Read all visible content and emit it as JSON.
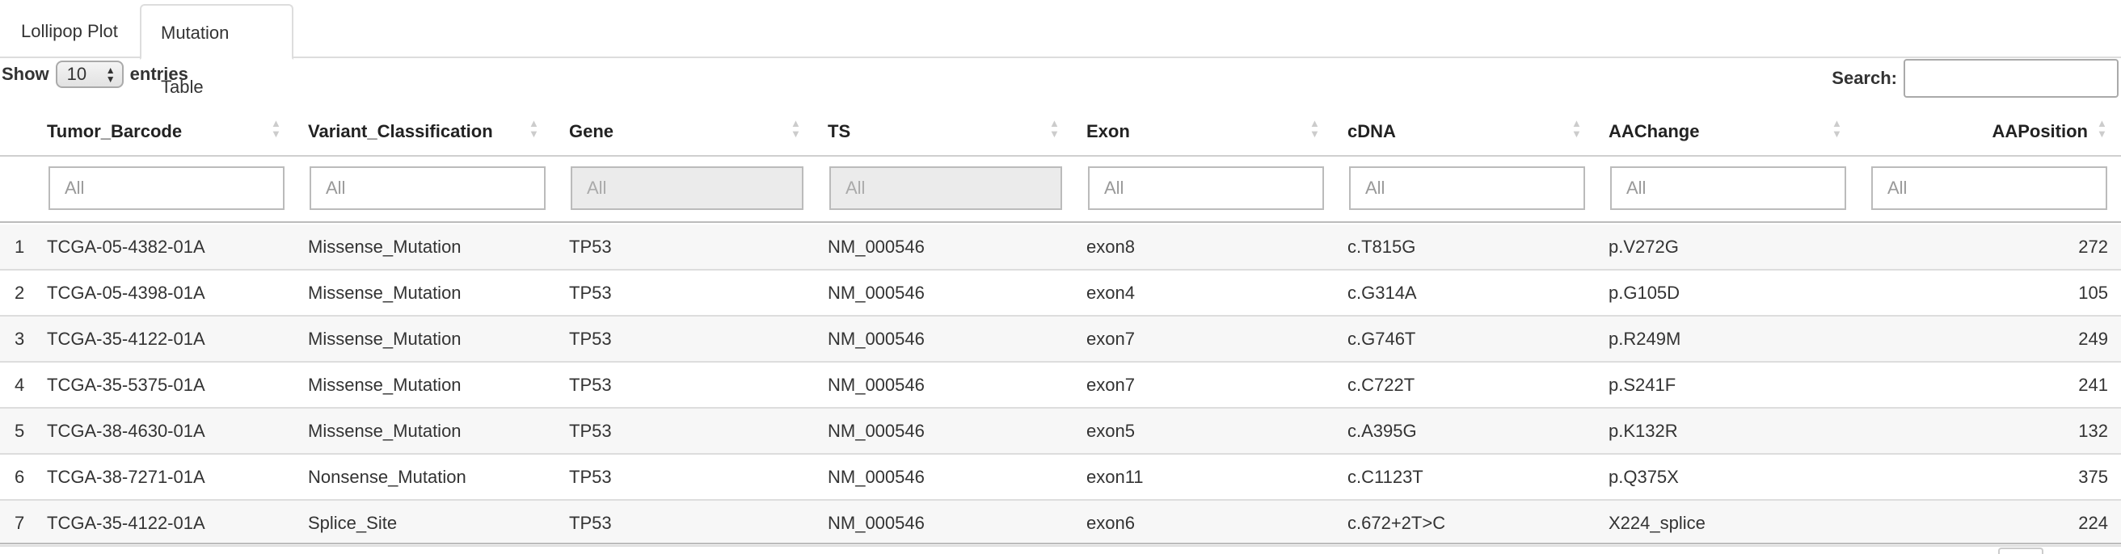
{
  "tabs": [
    {
      "label": "Lollipop Plot"
    },
    {
      "label": "Mutation Table"
    }
  ],
  "length": {
    "prefix": "Show",
    "value": "10",
    "suffix": "entries"
  },
  "search": {
    "label": "Search:",
    "value": ""
  },
  "columns": [
    "Tumor_Barcode",
    "Variant_Classification",
    "Gene",
    "TS",
    "Exon",
    "cDNA",
    "AAChange",
    "AAPosition"
  ],
  "filter_placeholder": "All",
  "rows": [
    {
      "n": "1",
      "Tumor_Barcode": "TCGA-05-4382-01A",
      "Variant_Classification": "Missense_Mutation",
      "Gene": "TP53",
      "TS": "NM_000546",
      "Exon": "exon8",
      "cDNA": "c.T815G",
      "AAChange": "p.V272G",
      "AAPosition": "272"
    },
    {
      "n": "2",
      "Tumor_Barcode": "TCGA-05-4398-01A",
      "Variant_Classification": "Missense_Mutation",
      "Gene": "TP53",
      "TS": "NM_000546",
      "Exon": "exon4",
      "cDNA": "c.G314A",
      "AAChange": "p.G105D",
      "AAPosition": "105"
    },
    {
      "n": "3",
      "Tumor_Barcode": "TCGA-35-4122-01A",
      "Variant_Classification": "Missense_Mutation",
      "Gene": "TP53",
      "TS": "NM_000546",
      "Exon": "exon7",
      "cDNA": "c.G746T",
      "AAChange": "p.R249M",
      "AAPosition": "249"
    },
    {
      "n": "4",
      "Tumor_Barcode": "TCGA-35-5375-01A",
      "Variant_Classification": "Missense_Mutation",
      "Gene": "TP53",
      "TS": "NM_000546",
      "Exon": "exon7",
      "cDNA": "c.C722T",
      "AAChange": "p.S241F",
      "AAPosition": "241"
    },
    {
      "n": "5",
      "Tumor_Barcode": "TCGA-38-4630-01A",
      "Variant_Classification": "Missense_Mutation",
      "Gene": "TP53",
      "TS": "NM_000546",
      "Exon": "exon5",
      "cDNA": "c.A395G",
      "AAChange": "p.K132R",
      "AAPosition": "132"
    },
    {
      "n": "6",
      "Tumor_Barcode": "TCGA-38-7271-01A",
      "Variant_Classification": "Nonsense_Mutation",
      "Gene": "TP53",
      "TS": "NM_000546",
      "Exon": "exon11",
      "cDNA": "c.C1123T",
      "AAChange": "p.Q375X",
      "AAPosition": "375"
    },
    {
      "n": "7",
      "Tumor_Barcode": "TCGA-35-4122-01A",
      "Variant_Classification": "Splice_Site",
      "Gene": "TP53",
      "TS": "NM_000546",
      "Exon": "exon6",
      "cDNA": "c.672+2T>C",
      "AAChange": "X224_splice",
      "AAPosition": "224"
    }
  ],
  "icons": {
    "sort": "sort-both-icon",
    "select_arrows": "updown-arrows-icon"
  }
}
